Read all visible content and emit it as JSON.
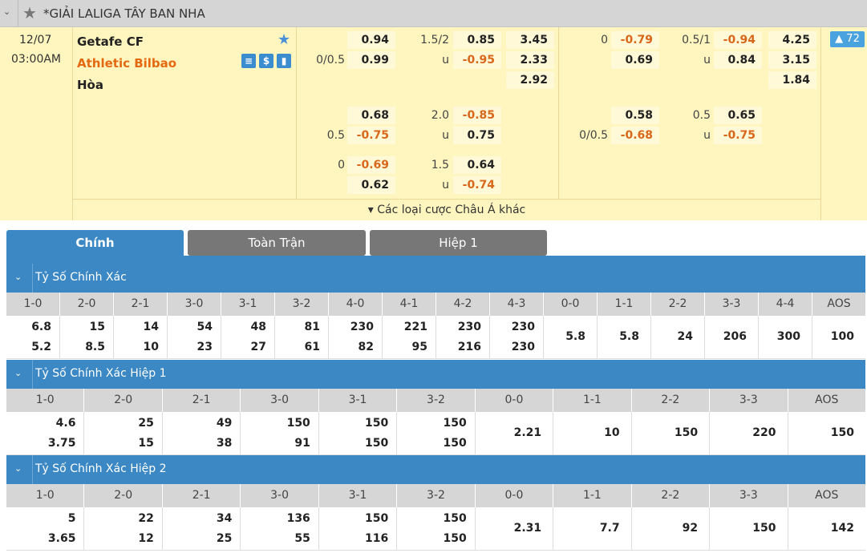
{
  "league": {
    "title": "*GIẢI LALIGA TÂY BAN NHA"
  },
  "match": {
    "date": "12/07",
    "time": "03:00AM",
    "home": "Getafe CF",
    "away": "Athletic Bilbao",
    "draw": "Hòa",
    "icons": [
      "stats-icon",
      "dollar-icon",
      "chart-icon"
    ],
    "more_count": "72",
    "more_label": "▾ Các loại cược Châu Á khác",
    "ft": [
      {
        "hcp_home": "",
        "hcp_line": "0/0.5",
        "hdp_h": "0.94",
        "hdp_a": "0.99",
        "ou_line": "1.5/2",
        "ou_u": "u",
        "ou_o": "0.85",
        "ou_un": "-0.95",
        "x1": "3.45",
        "x2": "2.33",
        "x3": "2.92"
      },
      {
        "hcp_line": "",
        "hcp_a_line": "0.5",
        "hdp_h": "0.68",
        "hdp_a": "-0.75",
        "ou_line": "2.0",
        "ou_u": "u",
        "ou_o": "-0.85",
        "ou_un": "0.75"
      },
      {
        "hcp_line": "0",
        "hdp_h": "-0.69",
        "hdp_a": "0.62",
        "ou_line": "1.5",
        "ou_u": "u",
        "ou_o": "0.64",
        "ou_un": "-0.74"
      }
    ],
    "ht": [
      {
        "hcp_line": "0",
        "hdp_h": "-0.79",
        "hdp_a": "0.69",
        "ou_line": "0.5/1",
        "ou_u": "u",
        "ou_o": "-0.94",
        "ou_un": "0.84",
        "x1": "4.25",
        "x2": "3.15",
        "x3": "1.84"
      },
      {
        "hcp_a_line": "0/0.5",
        "hdp_h": "0.58",
        "hdp_a": "-0.68",
        "ou_line": "0.5",
        "ou_u": "u",
        "ou_o": "0.65",
        "ou_un": "-0.75"
      }
    ]
  },
  "tabs": [
    {
      "label": "Chính",
      "active": true
    },
    {
      "label": "Toàn Trận",
      "active": false
    },
    {
      "label": "Hiệp 1",
      "active": false
    }
  ],
  "sections": [
    {
      "title": "Tỷ Số Chính Xác",
      "headers": [
        "1-0",
        "2-0",
        "2-1",
        "3-0",
        "3-1",
        "3-2",
        "4-0",
        "4-1",
        "4-2",
        "4-3",
        "0-0",
        "1-1",
        "2-2",
        "3-3",
        "4-4",
        "AOS"
      ],
      "values": [
        [
          "6.8",
          "5.2"
        ],
        [
          "15",
          "8.5"
        ],
        [
          "14",
          "10"
        ],
        [
          "54",
          "23"
        ],
        [
          "48",
          "27"
        ],
        [
          "81",
          "61"
        ],
        [
          "230",
          "82"
        ],
        [
          "221",
          "95"
        ],
        [
          "230",
          "216"
        ],
        [
          "230",
          "230"
        ],
        [
          "5.8"
        ],
        [
          "5.8"
        ],
        [
          "24"
        ],
        [
          "206"
        ],
        [
          "300"
        ],
        [
          "100"
        ]
      ]
    },
    {
      "title": "Tỷ Số Chính Xác Hiệp 1",
      "headers": [
        "1-0",
        "2-0",
        "2-1",
        "3-0",
        "3-1",
        "3-2",
        "0-0",
        "1-1",
        "2-2",
        "3-3",
        "AOS"
      ],
      "values": [
        [
          "4.6",
          "3.75"
        ],
        [
          "25",
          "15"
        ],
        [
          "49",
          "38"
        ],
        [
          "150",
          "91"
        ],
        [
          "150",
          "150"
        ],
        [
          "150",
          "150"
        ],
        [
          "2.21"
        ],
        [
          "10"
        ],
        [
          "150"
        ],
        [
          "220"
        ],
        [
          "150"
        ]
      ]
    },
    {
      "title": "Tỷ Số Chính Xác Hiệp 2",
      "headers": [
        "1-0",
        "2-0",
        "2-1",
        "3-0",
        "3-1",
        "3-2",
        "0-0",
        "1-1",
        "2-2",
        "3-3",
        "AOS"
      ],
      "values": [
        [
          "5",
          "3.65"
        ],
        [
          "22",
          "12"
        ],
        [
          "34",
          "25"
        ],
        [
          "136",
          "55"
        ],
        [
          "150",
          "116"
        ],
        [
          "150",
          "150"
        ],
        [
          "2.31"
        ],
        [
          "7.7"
        ],
        [
          "92"
        ],
        [
          "150"
        ],
        [
          "142"
        ]
      ]
    }
  ]
}
